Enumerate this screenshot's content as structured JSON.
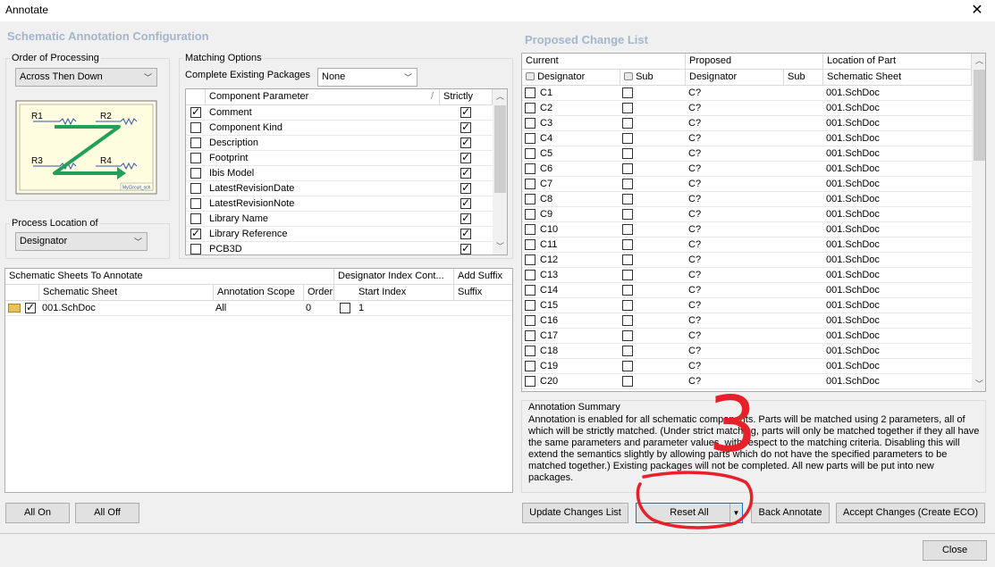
{
  "window": {
    "title": "Annotate"
  },
  "left": {
    "header": "Schematic Annotation Configuration",
    "order": {
      "label": "Order of Processing",
      "value": "Across Then Down"
    },
    "preview": {
      "labels": [
        "R1",
        "R2",
        "R3",
        "R4"
      ],
      "stamp": "MyCircuit_sch"
    },
    "process_location": {
      "label": "Process Location of",
      "value": "Designator"
    },
    "matching": {
      "label": "Matching Options",
      "complete_label": "Complete Existing Packages",
      "complete_value": "None",
      "col_param": "Component Parameter",
      "col_strictly": "Strictly",
      "params": [
        {
          "name": "Comment",
          "checked": true,
          "strict": true
        },
        {
          "name": "Component Kind",
          "checked": false,
          "strict": true
        },
        {
          "name": "Description",
          "checked": false,
          "strict": true
        },
        {
          "name": "Footprint",
          "checked": false,
          "strict": true
        },
        {
          "name": "Ibis Model",
          "checked": false,
          "strict": true
        },
        {
          "name": "LatestRevisionDate",
          "checked": false,
          "strict": true
        },
        {
          "name": "LatestRevisionNote",
          "checked": false,
          "strict": true
        },
        {
          "name": "Library Name",
          "checked": false,
          "strict": true
        },
        {
          "name": "Library Reference",
          "checked": true,
          "strict": true
        },
        {
          "name": "PCB3D",
          "checked": false,
          "strict": true
        }
      ]
    },
    "sheets": {
      "header1": "Schematic Sheets To Annotate",
      "header2": "Designator Index Cont...",
      "header3": "Add Suffix",
      "cols": [
        "Schematic Sheet",
        "Annotation Scope",
        "Order",
        "Start Index",
        "Suffix"
      ],
      "rows": [
        {
          "sheet": "001.SchDoc",
          "scope": "All",
          "order": "0",
          "start": "1",
          "suffix": ""
        }
      ]
    },
    "buttons": {
      "all_on": "All On",
      "all_off": "All Off"
    }
  },
  "right": {
    "header": "Proposed Change List",
    "group_headers": [
      "Current",
      "Proposed",
      "Location of Part"
    ],
    "cols": [
      "Designator",
      "Sub",
      "Designator",
      "Sub",
      "Schematic Sheet"
    ],
    "rows": [
      {
        "cur": "C1",
        "prop": "C?",
        "loc": "001.SchDoc"
      },
      {
        "cur": "C2",
        "prop": "C?",
        "loc": "001.SchDoc"
      },
      {
        "cur": "C3",
        "prop": "C?",
        "loc": "001.SchDoc"
      },
      {
        "cur": "C4",
        "prop": "C?",
        "loc": "001.SchDoc"
      },
      {
        "cur": "C5",
        "prop": "C?",
        "loc": "001.SchDoc"
      },
      {
        "cur": "C6",
        "prop": "C?",
        "loc": "001.SchDoc"
      },
      {
        "cur": "C7",
        "prop": "C?",
        "loc": "001.SchDoc"
      },
      {
        "cur": "C8",
        "prop": "C?",
        "loc": "001.SchDoc"
      },
      {
        "cur": "C9",
        "prop": "C?",
        "loc": "001.SchDoc"
      },
      {
        "cur": "C10",
        "prop": "C?",
        "loc": "001.SchDoc"
      },
      {
        "cur": "C11",
        "prop": "C?",
        "loc": "001.SchDoc"
      },
      {
        "cur": "C12",
        "prop": "C?",
        "loc": "001.SchDoc"
      },
      {
        "cur": "C13",
        "prop": "C?",
        "loc": "001.SchDoc"
      },
      {
        "cur": "C14",
        "prop": "C?",
        "loc": "001.SchDoc"
      },
      {
        "cur": "C15",
        "prop": "C?",
        "loc": "001.SchDoc"
      },
      {
        "cur": "C16",
        "prop": "C?",
        "loc": "001.SchDoc"
      },
      {
        "cur": "C17",
        "prop": "C?",
        "loc": "001.SchDoc"
      },
      {
        "cur": "C18",
        "prop": "C?",
        "loc": "001.SchDoc"
      },
      {
        "cur": "C19",
        "prop": "C?",
        "loc": "001.SchDoc"
      },
      {
        "cur": "C20",
        "prop": "C?",
        "loc": "001.SchDoc"
      }
    ],
    "summary": {
      "title": "Annotation Summary",
      "text": "Annotation is enabled for all schematic components. Parts will be matched using 2 parameters, all of which will be strictly matched. (Under strict matching, parts will only be matched together if they all have the same parameters and parameter values, with respect to the matching criteria. Disabling this will extend the semantics slightly by allowing parts which do not have the specified parameters to be matched together.) Existing packages will not be completed. All new parts will be put into new packages."
    },
    "buttons": {
      "update": "Update Changes List",
      "reset": "Reset All",
      "back": "Back Annotate",
      "accept": "Accept Changes (Create ECO)"
    }
  },
  "footer": {
    "close": "Close"
  },
  "annotation_mark": {
    "text": "3",
    "color": "#e8202a"
  }
}
